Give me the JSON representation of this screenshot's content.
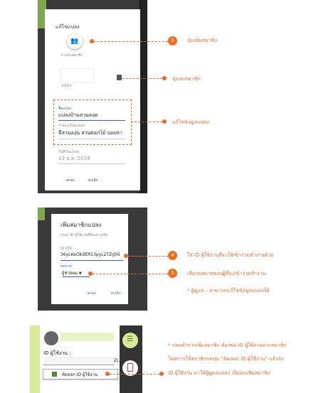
{
  "panel1": {
    "title": "แก้ไขแปลง",
    "member_label": "จานข้อสมาชิก",
    "member_role": "editor",
    "plot_name_label": "ชื่อแปลง",
    "plot_name_value": "แปลงบ้านสวนลอย",
    "plot_detail_label": "รายละเอียดแปลง",
    "plot_detail_value": "มีสวนองุ่น สวนดอกไม้ บอปลา",
    "start_date_label": "วันที่เริ่มแปลง",
    "start_date_value": "13 ธ.ค. 2018",
    "ok_label": "ตกลง",
    "cancel_label": "ยกเลิก"
  },
  "panel2": {
    "title": "เพิ่มสมาชิกแปลง",
    "hint": "กรอก ID ผู้ใช้งานที่ต้องการเพิ่ม",
    "id_label": "ID ผู้ใช้",
    "id_value": "36yLKeOKdER53pyL2TZg56",
    "role_label": "บทบาท",
    "role_value": "ผู้ช่วยผม",
    "ok_label": "ตกลง",
    "cancel_label": "ยกเลิก"
  },
  "panel3": {
    "user_id_label": "ID ผู้ใช้งาน :",
    "partial_text": "ZL",
    "copy_button_label": "คัดลอก ID ผู้ใช้งาน"
  },
  "annotations": {
    "add_member_num": "3",
    "add_member": "ปุ่มเพิ่มสมาชิก",
    "remove_member": "ปุ่มลบสมาชิก",
    "edit_info": "แก้ไขข้อมูลแปลง",
    "enter_id_num": "4",
    "enter_id": "ใส่ ID ผู้ใช้งานที่จะให้เข้าร่วมทำงานด้วย",
    "choose_role_num": "5",
    "choose_role": "เลือกบทบาทของผู้ที่จะเข้าร่วมทำงาน",
    "role_note": "* ผู้ดูแล – สามารถแก้ไขข้อมูลแปลงได้",
    "bottom_note_1": "* ก่อนทำการเพิ่มสมาชิก ต้องขอ ID ผู้ใช้งานจากสมาชิก",
    "bottom_note_2": "โดยการให้สมาชิกกดปุ่ม “คัดลอก ID ผู้ใช้งาน” แล้วส่ง",
    "bottom_note_3": "ID ผู้ใช้งาน มาให้ผู้ดูแลแปลง เป็นคนเพิ่มสมาชิก"
  },
  "colors": {
    "accent": "#e36a2c",
    "badge": "#ef6f1f",
    "field_underline": "#3a5fcd",
    "green_bg": "#d7ea9a",
    "dark_bg": "#3a3a3a"
  }
}
